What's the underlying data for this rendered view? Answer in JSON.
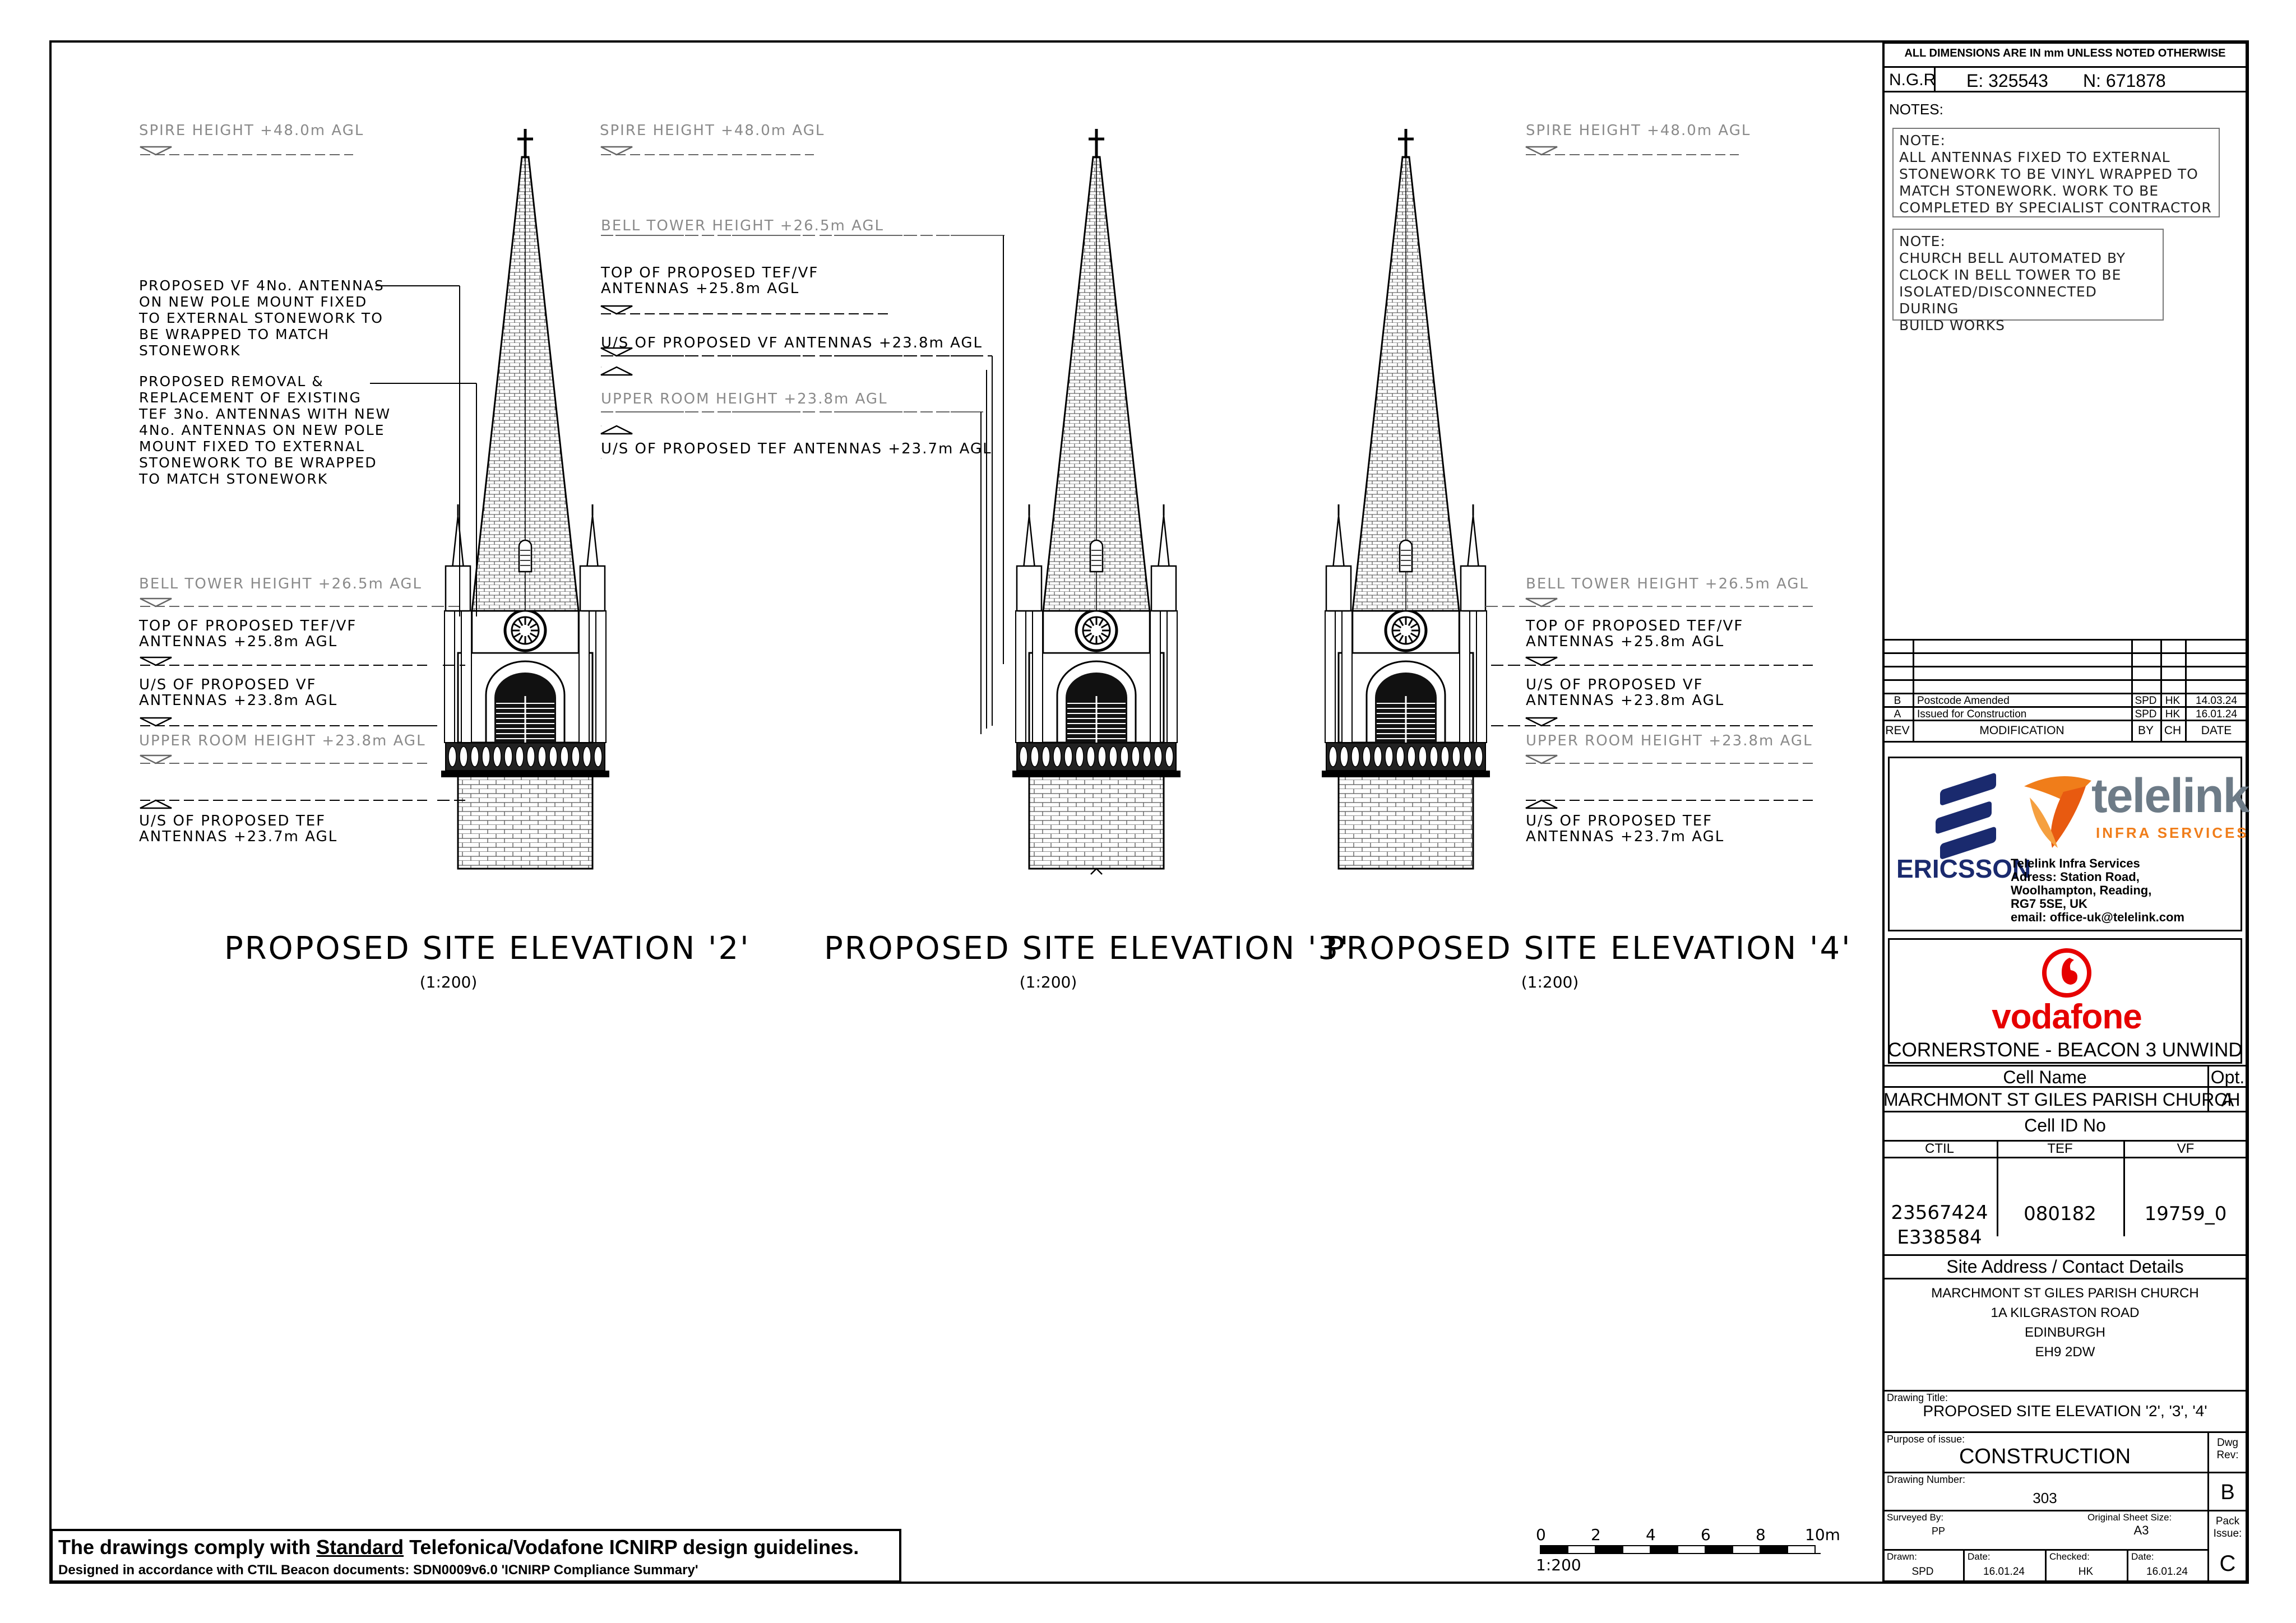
{
  "titleblock": {
    "dimensions_note": "ALL DIMENSIONS ARE IN mm UNLESS NOTED OTHERWISE",
    "ngr_label": "N.G.R",
    "easting": "E: 325543",
    "northing": "N: 671878",
    "notes_heading": "NOTES:",
    "note1": [
      "NOTE:",
      "ALL ANTENNAS FIXED TO EXTERNAL",
      "STONEWORK TO BE VINYL WRAPPED TO",
      "MATCH STONEWORK. WORK TO BE",
      "COMPLETED BY SPECIALIST CONTRACTOR"
    ],
    "note2": [
      "NOTE:",
      "CHURCH BELL AUTOMATED BY",
      "CLOCK IN BELL TOWER TO BE",
      "ISOLATED/DISCONNECTED DURING",
      "BUILD WORKS"
    ],
    "revisions": [
      {
        "rev": "B",
        "desc": "Postcode Amended",
        "by": "SPD",
        "ch": "HK",
        "date": "14.03.24"
      },
      {
        "rev": "A",
        "desc": "Issued for Construction",
        "by": "SPD",
        "ch": "HK",
        "date": "16.01.24"
      }
    ],
    "rev_headers": {
      "rev": "REV",
      "mod": "MODIFICATION",
      "by": "BY",
      "ch": "CH",
      "date": "DATE"
    },
    "ericsson": "ERICSSON",
    "telelink_main": "telelink",
    "telelink_sub": "INFRA SERVICES",
    "telelink_address": [
      "Telelink Infra Services",
      "Adress: Station Road,",
      "Woolhampton, Reading,",
      "RG7 5SE, UK",
      "email: office-uk@telelink.com"
    ],
    "vodafone": "vodafone",
    "project": "CORNERSTONE - BEACON 3 UNWIND",
    "cell_name_label": "Cell Name",
    "opt_label": "Opt.",
    "cell_name": "MARCHMONT ST GILES PARISH CHURCH",
    "opt": "A",
    "cell_id_label": "Cell ID No",
    "ctil_label": "CTIL",
    "tef_label": "TEF",
    "vf_label": "VF",
    "ctil_1": "23567424",
    "ctil_2": "E338584",
    "tef_id": "080182",
    "vf_id": "19759_0",
    "site_address_label": "Site Address / Contact Details",
    "address": [
      "MARCHMONT ST GILES PARISH CHURCH",
      "1A KILGRASTON ROAD",
      "EDINBURGH",
      "EH9 2DW"
    ],
    "drawing_title_label": "Drawing Title:",
    "drawing_title": "PROPOSED SITE ELEVATION '2', '3', '4'",
    "purpose_label": "Purpose of issue:",
    "purpose": "CONSTRUCTION",
    "dwg_rev_label": "Dwg Rev:",
    "drawing_number_label": "Drawing Number:",
    "drawing_number": "303",
    "dwg_rev": "B",
    "surveyed_label": "Surveyed By:",
    "surveyed": "PP",
    "sheet_size_label": "Original Sheet Size:",
    "sheet_size": "A3",
    "pack_label": "Pack Issue:",
    "drawn_label": "Drawn:",
    "drawn": "SPD",
    "date_label": "Date:",
    "drawn_date": "16.01.24",
    "checked_label": "Checked:",
    "checked": "HK",
    "checked_date": "16.01.24",
    "pack": "C"
  },
  "compliance": {
    "line1_pre": "The drawings comply with ",
    "line1_std": "Standard",
    "line1_post": " Telefonica/Vodafone ICNIRP design guidelines.",
    "line2": "Designed in accordance with CTIL Beacon documents: SDN0009v6.0 'ICNIRP Compliance Summary'"
  },
  "scale_bar": {
    "ticks": [
      "0",
      "2",
      "4",
      "6",
      "8",
      "10m"
    ],
    "ratio": "1:200"
  },
  "elevations": [
    {
      "title": "PROPOSED SITE ELEVATION '2'",
      "scale": "(1:200)"
    },
    {
      "title": "PROPOSED SITE ELEVATION '3'",
      "scale": "(1:200)"
    },
    {
      "title": "PROPOSED SITE ELEVATION '4'",
      "scale": "(1:200)"
    }
  ],
  "levels": {
    "spire": "SPIRE HEIGHT +48.0m AGL",
    "bell_tower": "BELL TOWER HEIGHT +26.5m AGL",
    "top_tef_vf_1": "TOP OF PROPOSED TEF/VF",
    "top_tef_vf_2": "ANTENNAS +25.8m AGL",
    "us_vf_1": "U/S OF PROPOSED VF",
    "us_vf_2": "ANTENNAS +23.8m AGL",
    "upper_room": "UPPER ROOM HEIGHT +23.8m AGL",
    "us_tef_1": "U/S OF PROPOSED TEF",
    "us_tef_2": "ANTENNAS +23.7m AGL",
    "e3_top_1": "TOP OF PROPOSED TEF/VF",
    "e3_top_2": "ANTENNAS +25.8m AGL",
    "e3_us_vf": "U/S OF PROPOSED VF ANTENNAS +23.8m AGL",
    "e3_us_tef": "U/S OF PROPOSED TEF ANTENNAS +23.7m AGL"
  },
  "callouts": {
    "vf": [
      "PROPOSED VF 4No. ANTENNAS",
      "ON NEW POLE MOUNT FIXED",
      "TO EXTERNAL STONEWORK TO",
      "BE WRAPPED TO MATCH",
      "STONEWORK"
    ],
    "tef": [
      "PROPOSED REMOVAL &",
      "REPLACEMENT OF EXISTING",
      "TEF 3No. ANTENNAS WITH NEW",
      "4No. ANTENNAS ON NEW POLE",
      "MOUNT FIXED TO EXTERNAL",
      "STONEWORK TO BE WRAPPED",
      "TO MATCH STONEWORK"
    ]
  },
  "colors": {
    "ericsson_blue": "#1a2a6e",
    "telelink_orange": "#f07d1a",
    "telelink_grey": "#6d7b87",
    "vodafone_red": "#e60000",
    "grey_text": "#8a8a8a"
  }
}
